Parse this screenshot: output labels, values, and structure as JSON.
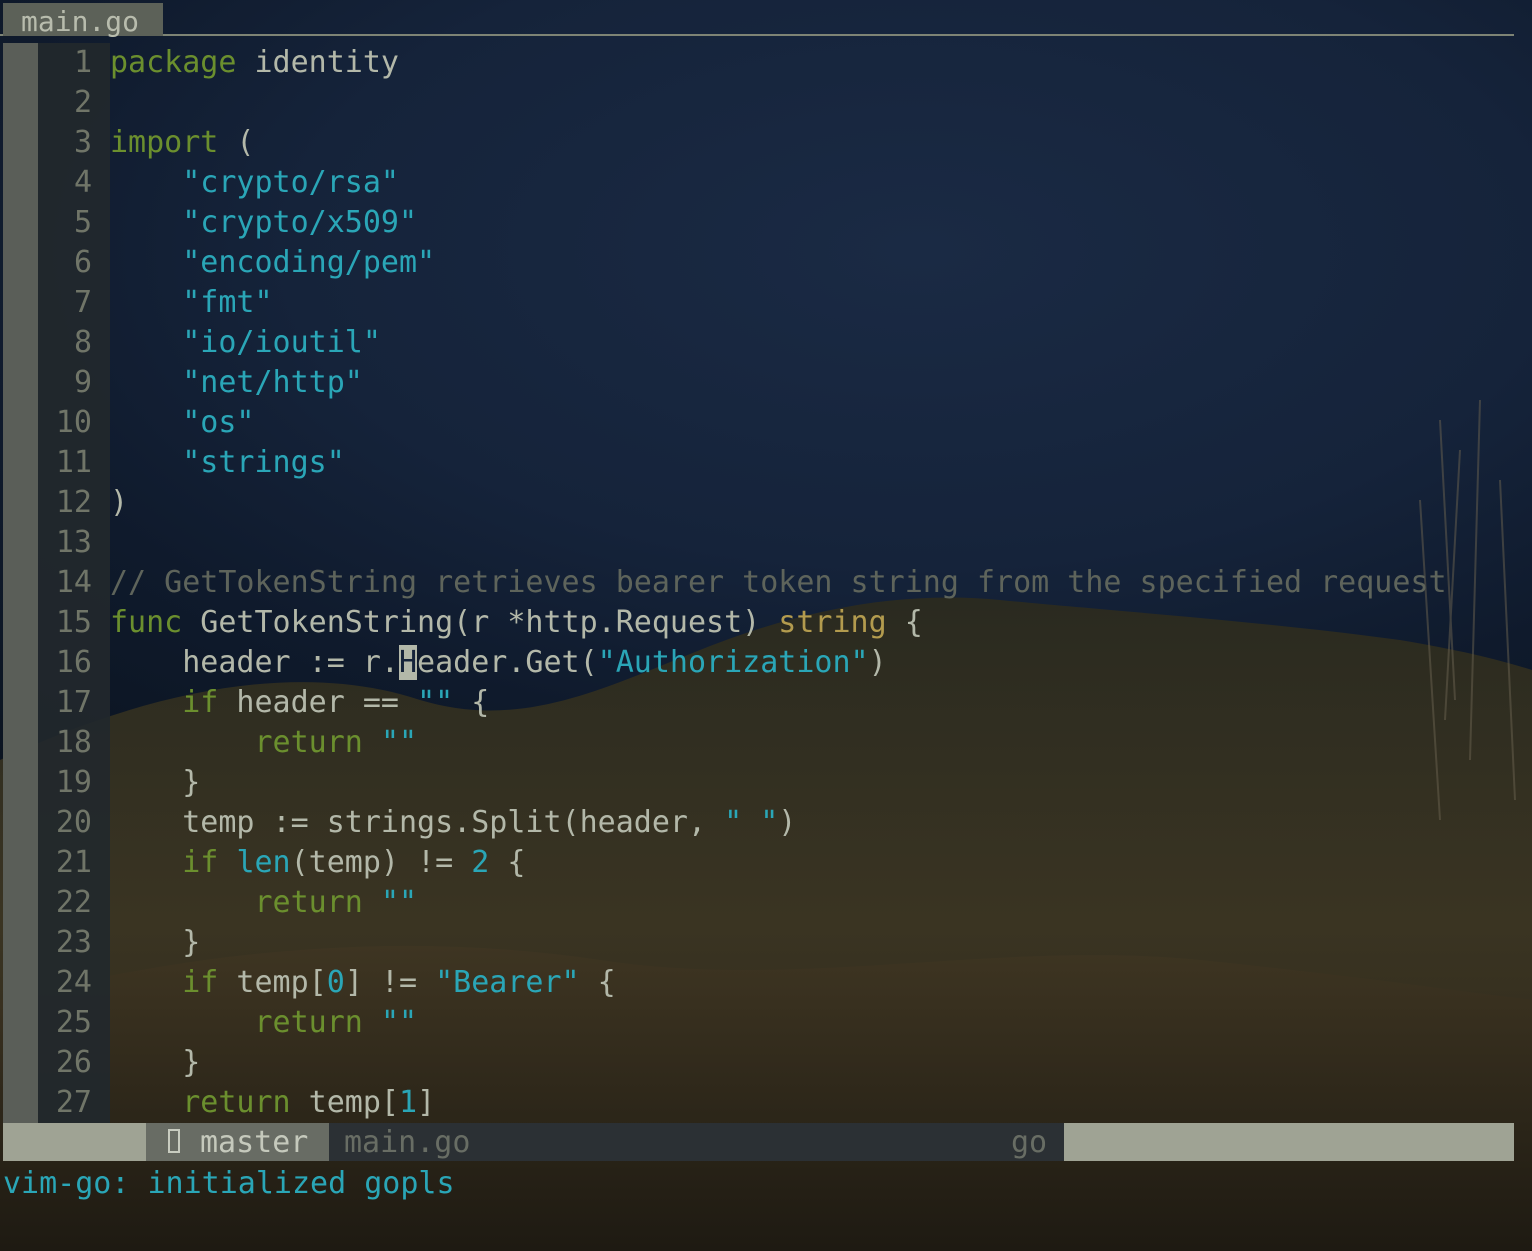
{
  "tab": {
    "filename": "main.go"
  },
  "lines": [
    {
      "n": "1",
      "tokens": [
        {
          "t": "package",
          "c": "kw"
        },
        {
          "t": " identity",
          "c": ""
        }
      ]
    },
    {
      "n": "2",
      "tokens": []
    },
    {
      "n": "3",
      "tokens": [
        {
          "t": "import",
          "c": "kw"
        },
        {
          "t": " (",
          "c": ""
        }
      ]
    },
    {
      "n": "4",
      "tokens": [
        {
          "t": "    ",
          "c": ""
        },
        {
          "t": "\"crypto/rsa\"",
          "c": "str"
        }
      ]
    },
    {
      "n": "5",
      "tokens": [
        {
          "t": "    ",
          "c": ""
        },
        {
          "t": "\"crypto/x509\"",
          "c": "str"
        }
      ]
    },
    {
      "n": "6",
      "tokens": [
        {
          "t": "    ",
          "c": ""
        },
        {
          "t": "\"encoding/pem\"",
          "c": "str"
        }
      ]
    },
    {
      "n": "7",
      "tokens": [
        {
          "t": "    ",
          "c": ""
        },
        {
          "t": "\"fmt\"",
          "c": "str"
        }
      ]
    },
    {
      "n": "8",
      "tokens": [
        {
          "t": "    ",
          "c": ""
        },
        {
          "t": "\"io/ioutil\"",
          "c": "str"
        }
      ]
    },
    {
      "n": "9",
      "tokens": [
        {
          "t": "    ",
          "c": ""
        },
        {
          "t": "\"net/http\"",
          "c": "str"
        }
      ]
    },
    {
      "n": "10",
      "tokens": [
        {
          "t": "    ",
          "c": ""
        },
        {
          "t": "\"os\"",
          "c": "str"
        }
      ]
    },
    {
      "n": "11",
      "tokens": [
        {
          "t": "    ",
          "c": ""
        },
        {
          "t": "\"strings\"",
          "c": "str"
        }
      ]
    },
    {
      "n": "12",
      "tokens": [
        {
          "t": ")",
          "c": ""
        }
      ]
    },
    {
      "n": "13",
      "tokens": []
    },
    {
      "n": "14",
      "tokens": [
        {
          "t": "// GetTokenString retrieves bearer token string from the specified request",
          "c": "cm"
        }
      ]
    },
    {
      "n": "15",
      "tokens": [
        {
          "t": "func",
          "c": "kw"
        },
        {
          "t": " GetTokenString(r *http.Request) ",
          "c": ""
        },
        {
          "t": "string",
          "c": "typ"
        },
        {
          "t": " {",
          "c": ""
        }
      ]
    },
    {
      "n": "16",
      "tokens": [
        {
          "t": "    header := r.",
          "c": ""
        },
        {
          "t": "H",
          "c": "cursor"
        },
        {
          "t": "eader.Get(",
          "c": ""
        },
        {
          "t": "\"Authorization\"",
          "c": "str"
        },
        {
          "t": ")",
          "c": ""
        }
      ]
    },
    {
      "n": "17",
      "tokens": [
        {
          "t": "    ",
          "c": ""
        },
        {
          "t": "if",
          "c": "kw"
        },
        {
          "t": " header == ",
          "c": ""
        },
        {
          "t": "\"\"",
          "c": "str"
        },
        {
          "t": " {",
          "c": ""
        }
      ]
    },
    {
      "n": "18",
      "tokens": [
        {
          "t": "        ",
          "c": ""
        },
        {
          "t": "return",
          "c": "kw"
        },
        {
          "t": " ",
          "c": ""
        },
        {
          "t": "\"\"",
          "c": "str"
        }
      ]
    },
    {
      "n": "19",
      "tokens": [
        {
          "t": "    }",
          "c": ""
        }
      ]
    },
    {
      "n": "20",
      "tokens": [
        {
          "t": "    temp := strings.Split(header, ",
          "c": ""
        },
        {
          "t": "\" \"",
          "c": "str"
        },
        {
          "t": ")",
          "c": ""
        }
      ]
    },
    {
      "n": "21",
      "tokens": [
        {
          "t": "    ",
          "c": ""
        },
        {
          "t": "if",
          "c": "kw"
        },
        {
          "t": " ",
          "c": ""
        },
        {
          "t": "len",
          "c": "bi"
        },
        {
          "t": "(temp) != ",
          "c": ""
        },
        {
          "t": "2",
          "c": "num"
        },
        {
          "t": " {",
          "c": ""
        }
      ]
    },
    {
      "n": "22",
      "tokens": [
        {
          "t": "        ",
          "c": ""
        },
        {
          "t": "return",
          "c": "kw"
        },
        {
          "t": " ",
          "c": ""
        },
        {
          "t": "\"\"",
          "c": "str"
        }
      ]
    },
    {
      "n": "23",
      "tokens": [
        {
          "t": "    }",
          "c": ""
        }
      ]
    },
    {
      "n": "24",
      "tokens": [
        {
          "t": "    ",
          "c": ""
        },
        {
          "t": "if",
          "c": "kw"
        },
        {
          "t": " temp[",
          "c": ""
        },
        {
          "t": "0",
          "c": "num"
        },
        {
          "t": "] != ",
          "c": ""
        },
        {
          "t": "\"Bearer\"",
          "c": "str"
        },
        {
          "t": " {",
          "c": ""
        }
      ]
    },
    {
      "n": "25",
      "tokens": [
        {
          "t": "        ",
          "c": ""
        },
        {
          "t": "return",
          "c": "kw"
        },
        {
          "t": " ",
          "c": ""
        },
        {
          "t": "\"\"",
          "c": "str"
        }
      ]
    },
    {
      "n": "26",
      "tokens": [
        {
          "t": "    }",
          "c": ""
        }
      ]
    },
    {
      "n": "27",
      "tokens": [
        {
          "t": "    ",
          "c": ""
        },
        {
          "t": "return",
          "c": "kw"
        },
        {
          "t": " temp[",
          "c": ""
        },
        {
          "t": "1",
          "c": "num"
        },
        {
          "t": "]",
          "c": ""
        }
      ]
    }
  ],
  "statusline": {
    "branch_icon": "branch-icon",
    "branch": "master",
    "filename": "main.go",
    "filetype": "go"
  },
  "cmdline": {
    "message": "vim-go: initialized gopls"
  },
  "colors": {
    "keyword": "#6b8f2e",
    "string": "#2aa6b7",
    "type": "#b39b4e",
    "comment": "#5e645b",
    "text": "#b3b8a9"
  }
}
